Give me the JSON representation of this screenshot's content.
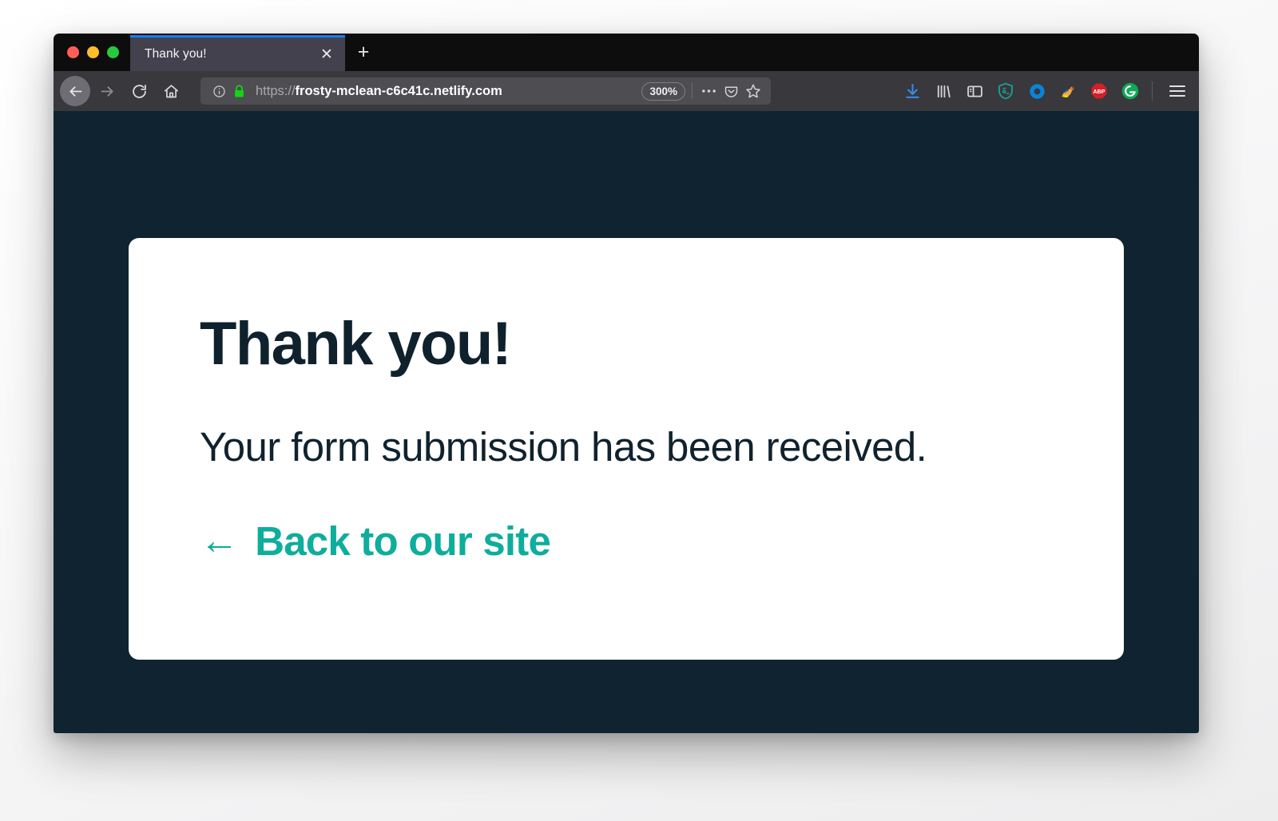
{
  "window": {
    "traffic_lights": [
      {
        "name": "close",
        "color": "#ff5f56"
      },
      {
        "name": "minimize",
        "color": "#fdbd2e"
      },
      {
        "name": "maximize",
        "color": "#27c93f"
      }
    ]
  },
  "tabs": {
    "active": {
      "title": "Thank you!",
      "close_label": "✕",
      "accent_color": "#0a84ff"
    },
    "new_tab_label": "+"
  },
  "toolbar": {
    "back_icon": "back-arrow-icon",
    "forward_icon": "forward-arrow-icon",
    "reload_icon": "reload-icon",
    "home_icon": "home-icon",
    "identity_icon": "info-circle-icon",
    "lock_icon": "padlock-icon",
    "url": {
      "scheme": "https://",
      "host": "frosty-mclean-c6c41c.netlify.com",
      "full": "https://frosty-mclean-c6c41c.netlify.com"
    },
    "zoom_level": "300%",
    "page_actions_icon": "ellipsis-icon",
    "pocket_icon": "pocket-icon",
    "bookmark_icon": "star-icon",
    "extensions": [
      {
        "name": "downloads-icon",
        "label": ""
      },
      {
        "name": "library-icon",
        "label": ""
      },
      {
        "name": "sidebar-toggle-icon",
        "label": ""
      },
      {
        "name": "privacy-badger-icon",
        "label": ""
      },
      {
        "name": "office-icon",
        "label": ""
      },
      {
        "name": "honey-icon",
        "label": ""
      },
      {
        "name": "adblock-plus-icon",
        "label": "ABP"
      },
      {
        "name": "grammarly-icon",
        "label": "G"
      }
    ],
    "menu_icon": "hamburger-menu-icon"
  },
  "page": {
    "background_color": "#0f2430",
    "card_background": "#ffffff",
    "heading": "Thank you!",
    "message": "Your form submission has been received.",
    "back_link": {
      "arrow": "←",
      "label": "Back to our site",
      "color": "#0ead9c"
    }
  }
}
